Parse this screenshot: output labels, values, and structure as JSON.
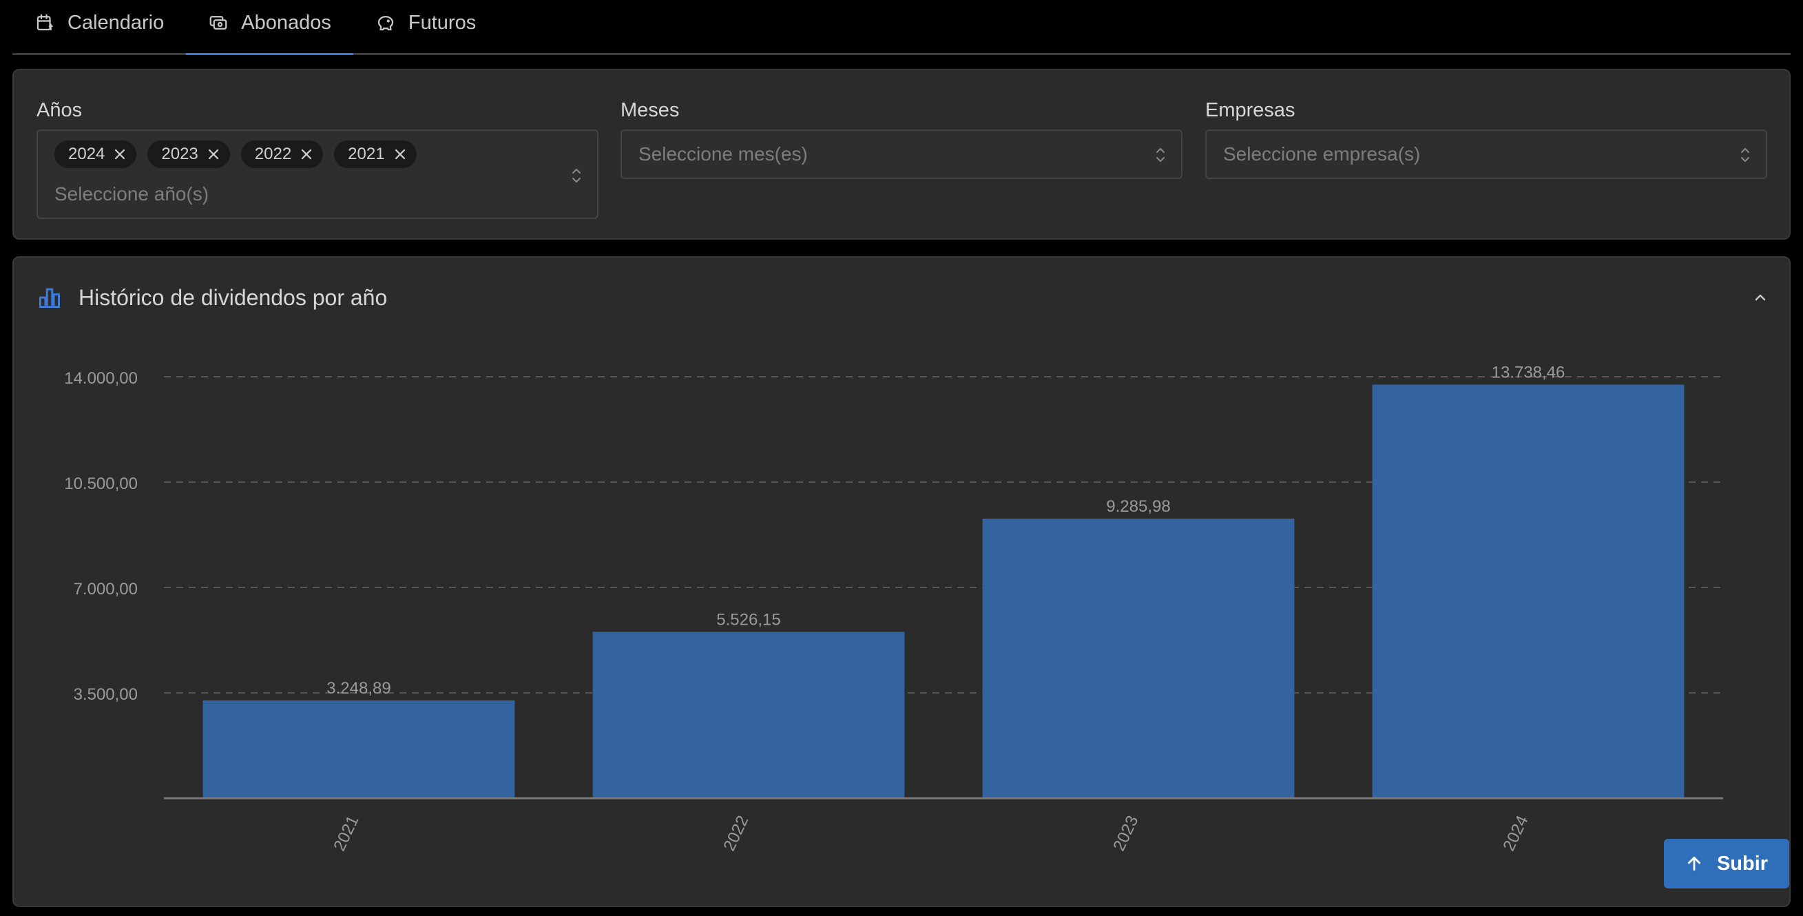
{
  "tabs": [
    {
      "label": "Calendario",
      "icon": "calendar-icon",
      "active": false
    },
    {
      "label": "Abonados",
      "icon": "money-icon",
      "active": true
    },
    {
      "label": "Futuros",
      "icon": "piggy-bank-icon",
      "active": false
    }
  ],
  "filters": {
    "years": {
      "label": "Años",
      "selected": [
        "2024",
        "2023",
        "2022",
        "2021"
      ],
      "placeholder": "Seleccione año(s)"
    },
    "months": {
      "label": "Meses",
      "placeholder": "Seleccione mes(es)"
    },
    "companies": {
      "label": "Empresas",
      "placeholder": "Seleccione empresa(s)"
    }
  },
  "chart_card": {
    "title": "Histórico de dividendos por año",
    "icon": "bar-chart-icon"
  },
  "chart_data": {
    "type": "bar",
    "categories": [
      "2021",
      "2022",
      "2023",
      "2024"
    ],
    "values": [
      3248.89,
      5526.15,
      9285.98,
      13738.46
    ],
    "value_labels": [
      "3.248,89",
      "5.526,15",
      "9.285,98",
      "13.738,46"
    ],
    "yticks": [
      3500,
      7000,
      10500,
      14000
    ],
    "ytick_labels": [
      "3.500,00",
      "7.000,00",
      "10.500,00",
      "14.000,00"
    ],
    "ylim": [
      0,
      14000
    ],
    "grid": true,
    "bar_color": "#3364a0"
  },
  "scroll_top_button": {
    "label": "Subir"
  },
  "colors": {
    "accent": "#3d7bd9",
    "button": "#2f6eb8"
  }
}
